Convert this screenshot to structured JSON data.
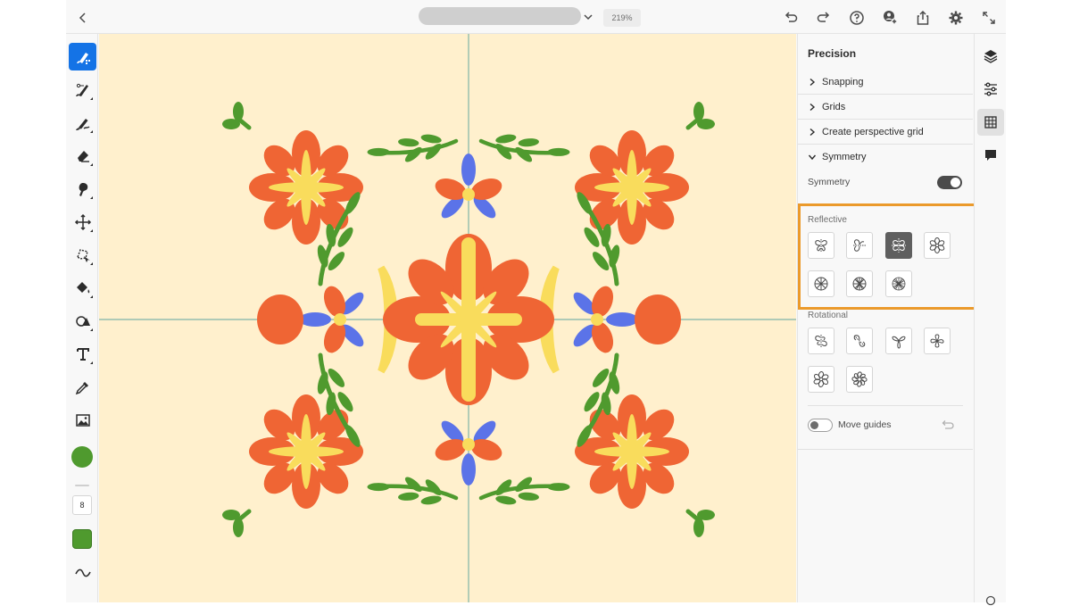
{
  "header": {
    "zoom": "219%",
    "icons": [
      "back-icon",
      "undo-icon",
      "redo-icon",
      "help-icon",
      "invite-icon",
      "share-icon",
      "settings-icon",
      "fullscreen-icon"
    ]
  },
  "toolbar": {
    "tools": [
      "pixel-brush",
      "vector-brush",
      "live-brush",
      "eraser",
      "smudge",
      "transform",
      "lasso",
      "fill",
      "shape",
      "text",
      "eyedropper",
      "image"
    ],
    "brush_color": "#4f9a2e",
    "brush_size": "8"
  },
  "panel": {
    "title": "Precision",
    "sections": [
      {
        "label": "Snapping",
        "expanded": false
      },
      {
        "label": "Grids",
        "expanded": false
      },
      {
        "label": "Create perspective grid",
        "expanded": false
      },
      {
        "label": "Symmetry",
        "expanded": true
      }
    ],
    "symmetry_label": "Symmetry",
    "symmetry_enabled": true,
    "reflective_label": "Reflective",
    "reflective_selected_index": 2,
    "rotational_label": "Rotational",
    "move_guides_label": "Move guides",
    "move_guides_enabled": false
  },
  "rail": {
    "icons": [
      "layers-icon",
      "properties-icon",
      "precision-icon",
      "comments-icon"
    ],
    "active": "precision-icon"
  },
  "colors": {
    "canvas_bg": "#fff0cd",
    "petal_orange": "#ef6534",
    "petal_yellow": "#f9dc5c",
    "petal_blue": "#5b73e8",
    "leaf_green": "#4f9a2e",
    "guide_line": "#7fb3a8",
    "highlight": "#eb9a2b",
    "accent": "#1473e6"
  }
}
